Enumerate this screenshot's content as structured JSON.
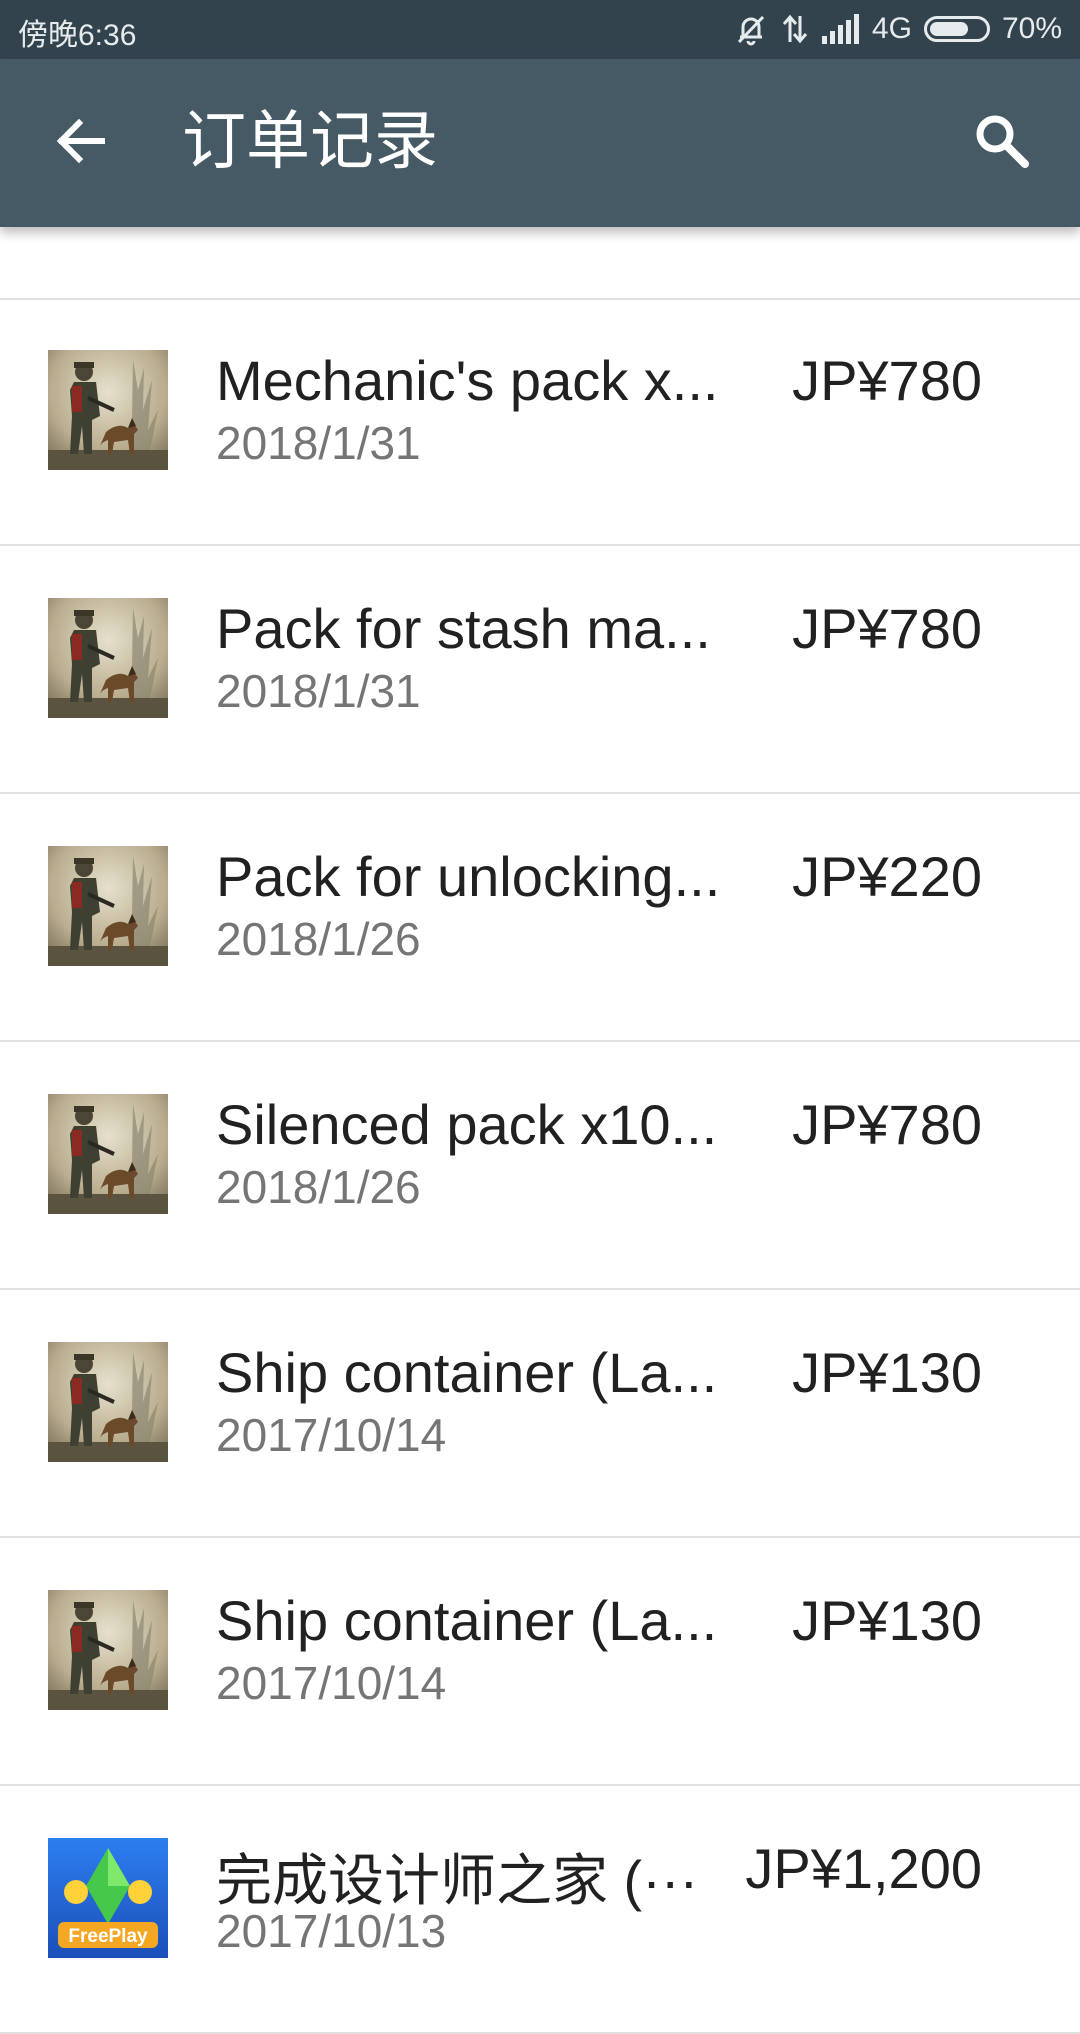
{
  "status_bar": {
    "time": "傍晚6:36",
    "network": "4G",
    "battery": "70%",
    "battery_level": 0.7,
    "icons": [
      "silent-bell-icon",
      "data-arrows-icon",
      "signal-bars-icon",
      "battery-icon"
    ]
  },
  "app_bar": {
    "title": "订单记录",
    "back_icon": "arrow-back-icon",
    "search_icon": "search-icon",
    "background_color": "#455a65"
  },
  "orders": [
    {
      "name": "Mechanic's pack x...",
      "date": "2018/1/31",
      "price": "JP¥780",
      "app": "soldier-dog"
    },
    {
      "name": "Pack for stash ma...",
      "date": "2018/1/31",
      "price": "JP¥780",
      "app": "soldier-dog"
    },
    {
      "name": "Pack for unlocking...",
      "date": "2018/1/26",
      "price": "JP¥220",
      "app": "soldier-dog"
    },
    {
      "name": "Silenced pack x10...",
      "date": "2018/1/26",
      "price": "JP¥780",
      "app": "soldier-dog"
    },
    {
      "name": "Ship container (La...",
      "date": "2017/10/14",
      "price": "JP¥130",
      "app": "soldier-dog"
    },
    {
      "name": "Ship container (La...",
      "date": "2017/10/14",
      "price": "JP¥130",
      "app": "soldier-dog"
    },
    {
      "name": "完成设计师之家 (···",
      "date": "2017/10/13",
      "price": "JP¥1,200",
      "app": "freeplay",
      "badge": "FreePlay"
    }
  ]
}
